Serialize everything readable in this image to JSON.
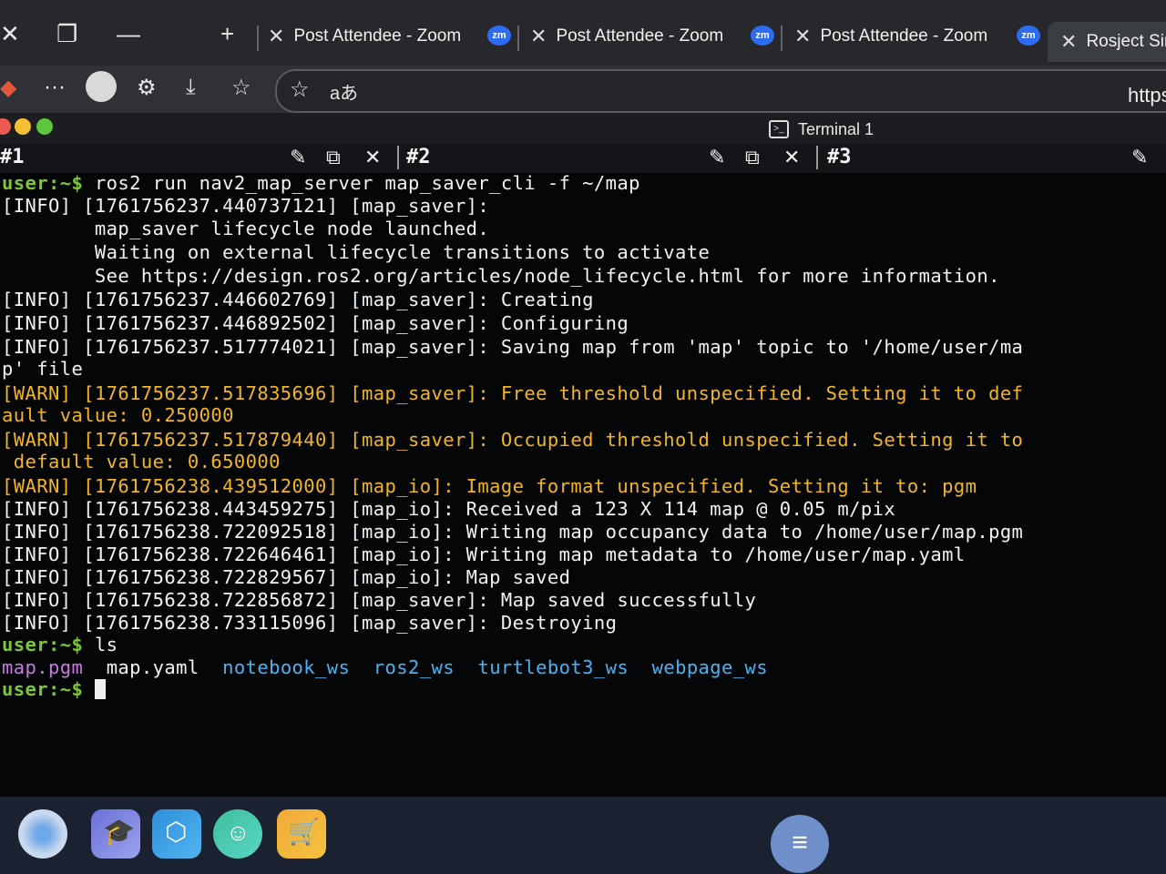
{
  "browser": {
    "tabs": [
      {
        "label": "Post Attendee - Zoom"
      },
      {
        "label": "Post Attendee - Zoom"
      },
      {
        "label": "Post Attendee - Zoom"
      },
      {
        "label": "Rosject Sim"
      }
    ],
    "zoom_badge": "zm",
    "url": "https://",
    "read_aloud_label": "aあ"
  },
  "terminal": {
    "title": "Terminal 1",
    "panes": [
      "#1",
      "#2",
      "#3"
    ],
    "lines": [
      {
        "kind": "prompt",
        "user": "user:~$",
        "cmd": " ros2 run nav2_map_server map_saver_cli -f ~/map"
      },
      {
        "kind": "info",
        "text": "[INFO] [1761756237.440737121] [map_saver]:"
      },
      {
        "kind": "info",
        "text": "        map_saver lifecycle node launched."
      },
      {
        "kind": "info",
        "text": "        Waiting on external lifecycle transitions to activate"
      },
      {
        "kind": "info",
        "text": "        See https://design.ros2.org/articles/node_lifecycle.html for more information."
      },
      {
        "kind": "info",
        "text": "[INFO] [1761756237.446602769] [map_saver]: Creating"
      },
      {
        "kind": "info",
        "text": "[INFO] [1761756237.446892502] [map_saver]: Configuring"
      },
      {
        "kind": "info",
        "text": "[INFO] [1761756237.517774021] [map_saver]: Saving map from 'map' topic to '/home/user/ma"
      },
      {
        "kind": "info",
        "text": "p' file"
      },
      {
        "kind": "warn",
        "text": "[WARN] [1761756237.517835696] [map_saver]: Free threshold unspecified. Setting it to def"
      },
      {
        "kind": "warn",
        "text": "ault value: 0.250000"
      },
      {
        "kind": "warn",
        "text": "[WARN] [1761756237.517879440] [map_saver]: Occupied threshold unspecified. Setting it to"
      },
      {
        "kind": "warn",
        "text": " default value: 0.650000"
      },
      {
        "kind": "warn",
        "text": "[WARN] [1761756238.439512000] [map_io]: Image format unspecified. Setting it to: pgm"
      },
      {
        "kind": "info",
        "text": "[INFO] [1761756238.443459275] [map_io]: Received a 123 X 114 map @ 0.05 m/pix"
      },
      {
        "kind": "info",
        "text": "[INFO] [1761756238.722092518] [map_io]: Writing map occupancy data to /home/user/map.pgm"
      },
      {
        "kind": "info",
        "text": "[INFO] [1761756238.722646461] [map_io]: Writing map metadata to /home/user/map.yaml"
      },
      {
        "kind": "info",
        "text": "[INFO] [1761756238.722829567] [map_io]: Map saved"
      },
      {
        "kind": "info",
        "text": "[INFO] [1761756238.722856872] [map_saver]: Map saved successfully"
      },
      {
        "kind": "info",
        "text": "[INFO] [1761756238.733115096] [map_saver]: Destroying"
      },
      {
        "kind": "prompt",
        "user": "user:~$",
        "cmd": " ls"
      }
    ],
    "ls_output": [
      {
        "name": "map.pgm",
        "type": "image"
      },
      {
        "name": "map.yaml",
        "type": "file"
      },
      {
        "name": "notebook_ws",
        "type": "dir"
      },
      {
        "name": "ros2_ws",
        "type": "dir"
      },
      {
        "name": "turtlebot3_ws",
        "type": "dir"
      },
      {
        "name": "webpage_ws",
        "type": "dir"
      }
    ],
    "final_prompt": "user:~$"
  },
  "colors": {
    "info_text": "#f2f2f2",
    "warn_text": "#f2b52a",
    "prompt": "#7ec53b",
    "directory": "#4ab2f0",
    "image_file": "#c77ae0"
  },
  "taskbar": {
    "apps": [
      "app-icon-1",
      "graduation-cap-icon",
      "cube-icon",
      "robot-icon",
      "cart-icon"
    ],
    "menu_icon": "hamburger-icon"
  }
}
